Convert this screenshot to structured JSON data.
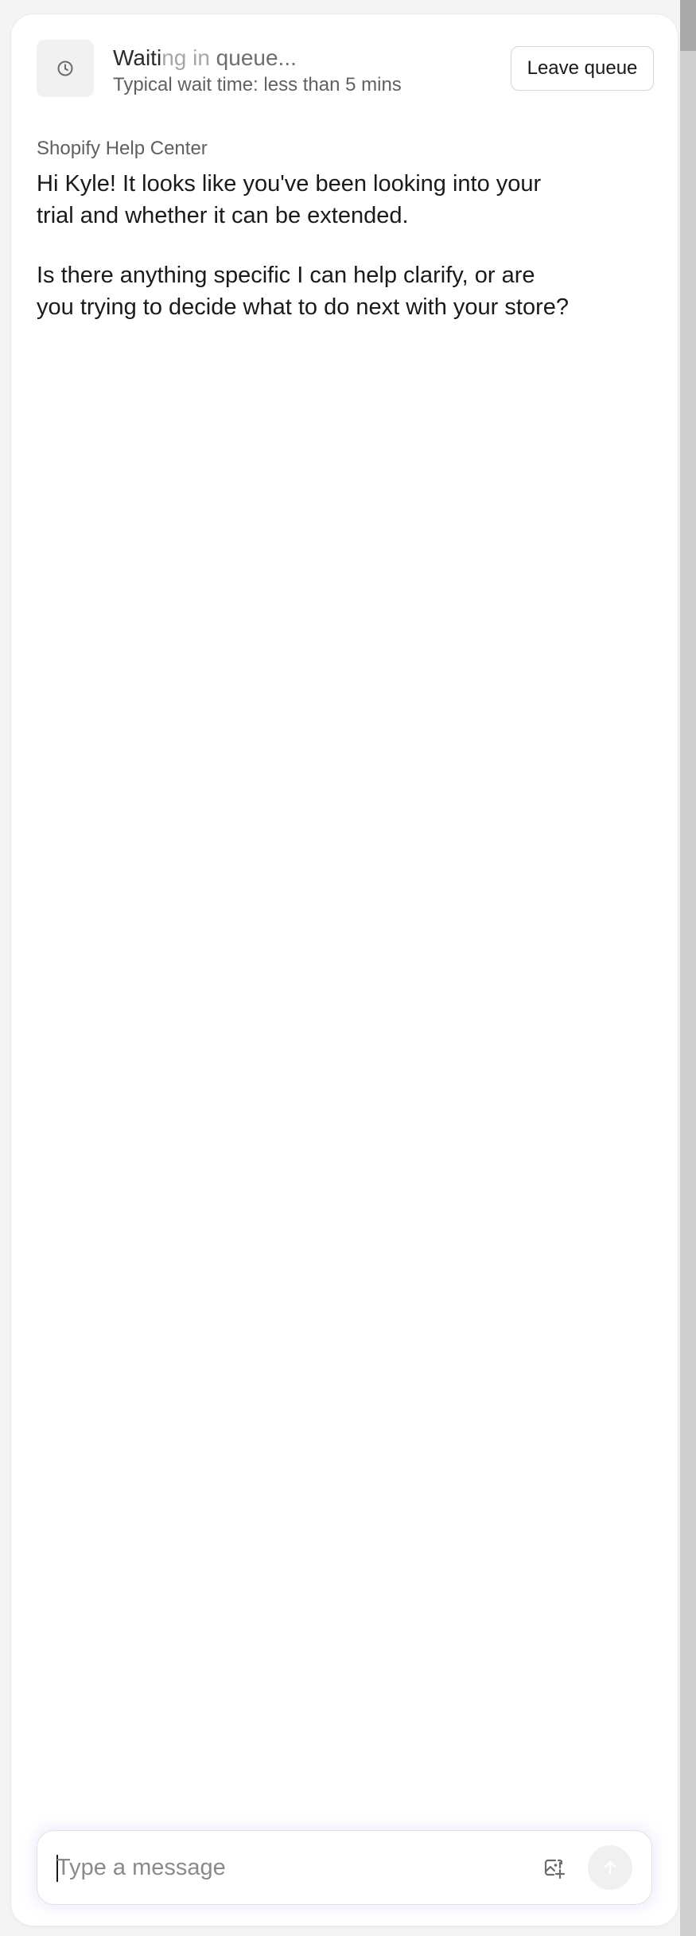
{
  "header": {
    "icon": "clock-icon",
    "title_part1": "Waiti",
    "title_part2": "ng in",
    "title_part3": " queue...",
    "subtitle": "Typical wait time: less than 5 mins",
    "leave_label": "Leave queue"
  },
  "messages": [
    {
      "sender": "Shopify Help Center",
      "paragraphs": [
        "Hi Kyle! It looks like you've been looking into your trial and whether it can be extended.",
        "Is there anything specific I can help clarify, or are you trying to decide what to do next with your store?"
      ]
    }
  ],
  "composer": {
    "placeholder": "Type a message",
    "attach_icon": "image-add-icon",
    "send_icon": "arrow-up-icon"
  },
  "colors": {
    "panel_bg": "#ffffff",
    "page_bg": "#f4f4f4",
    "text": "#1a1a1a",
    "muted": "#616161",
    "composer_glow": "#beA0ff"
  }
}
